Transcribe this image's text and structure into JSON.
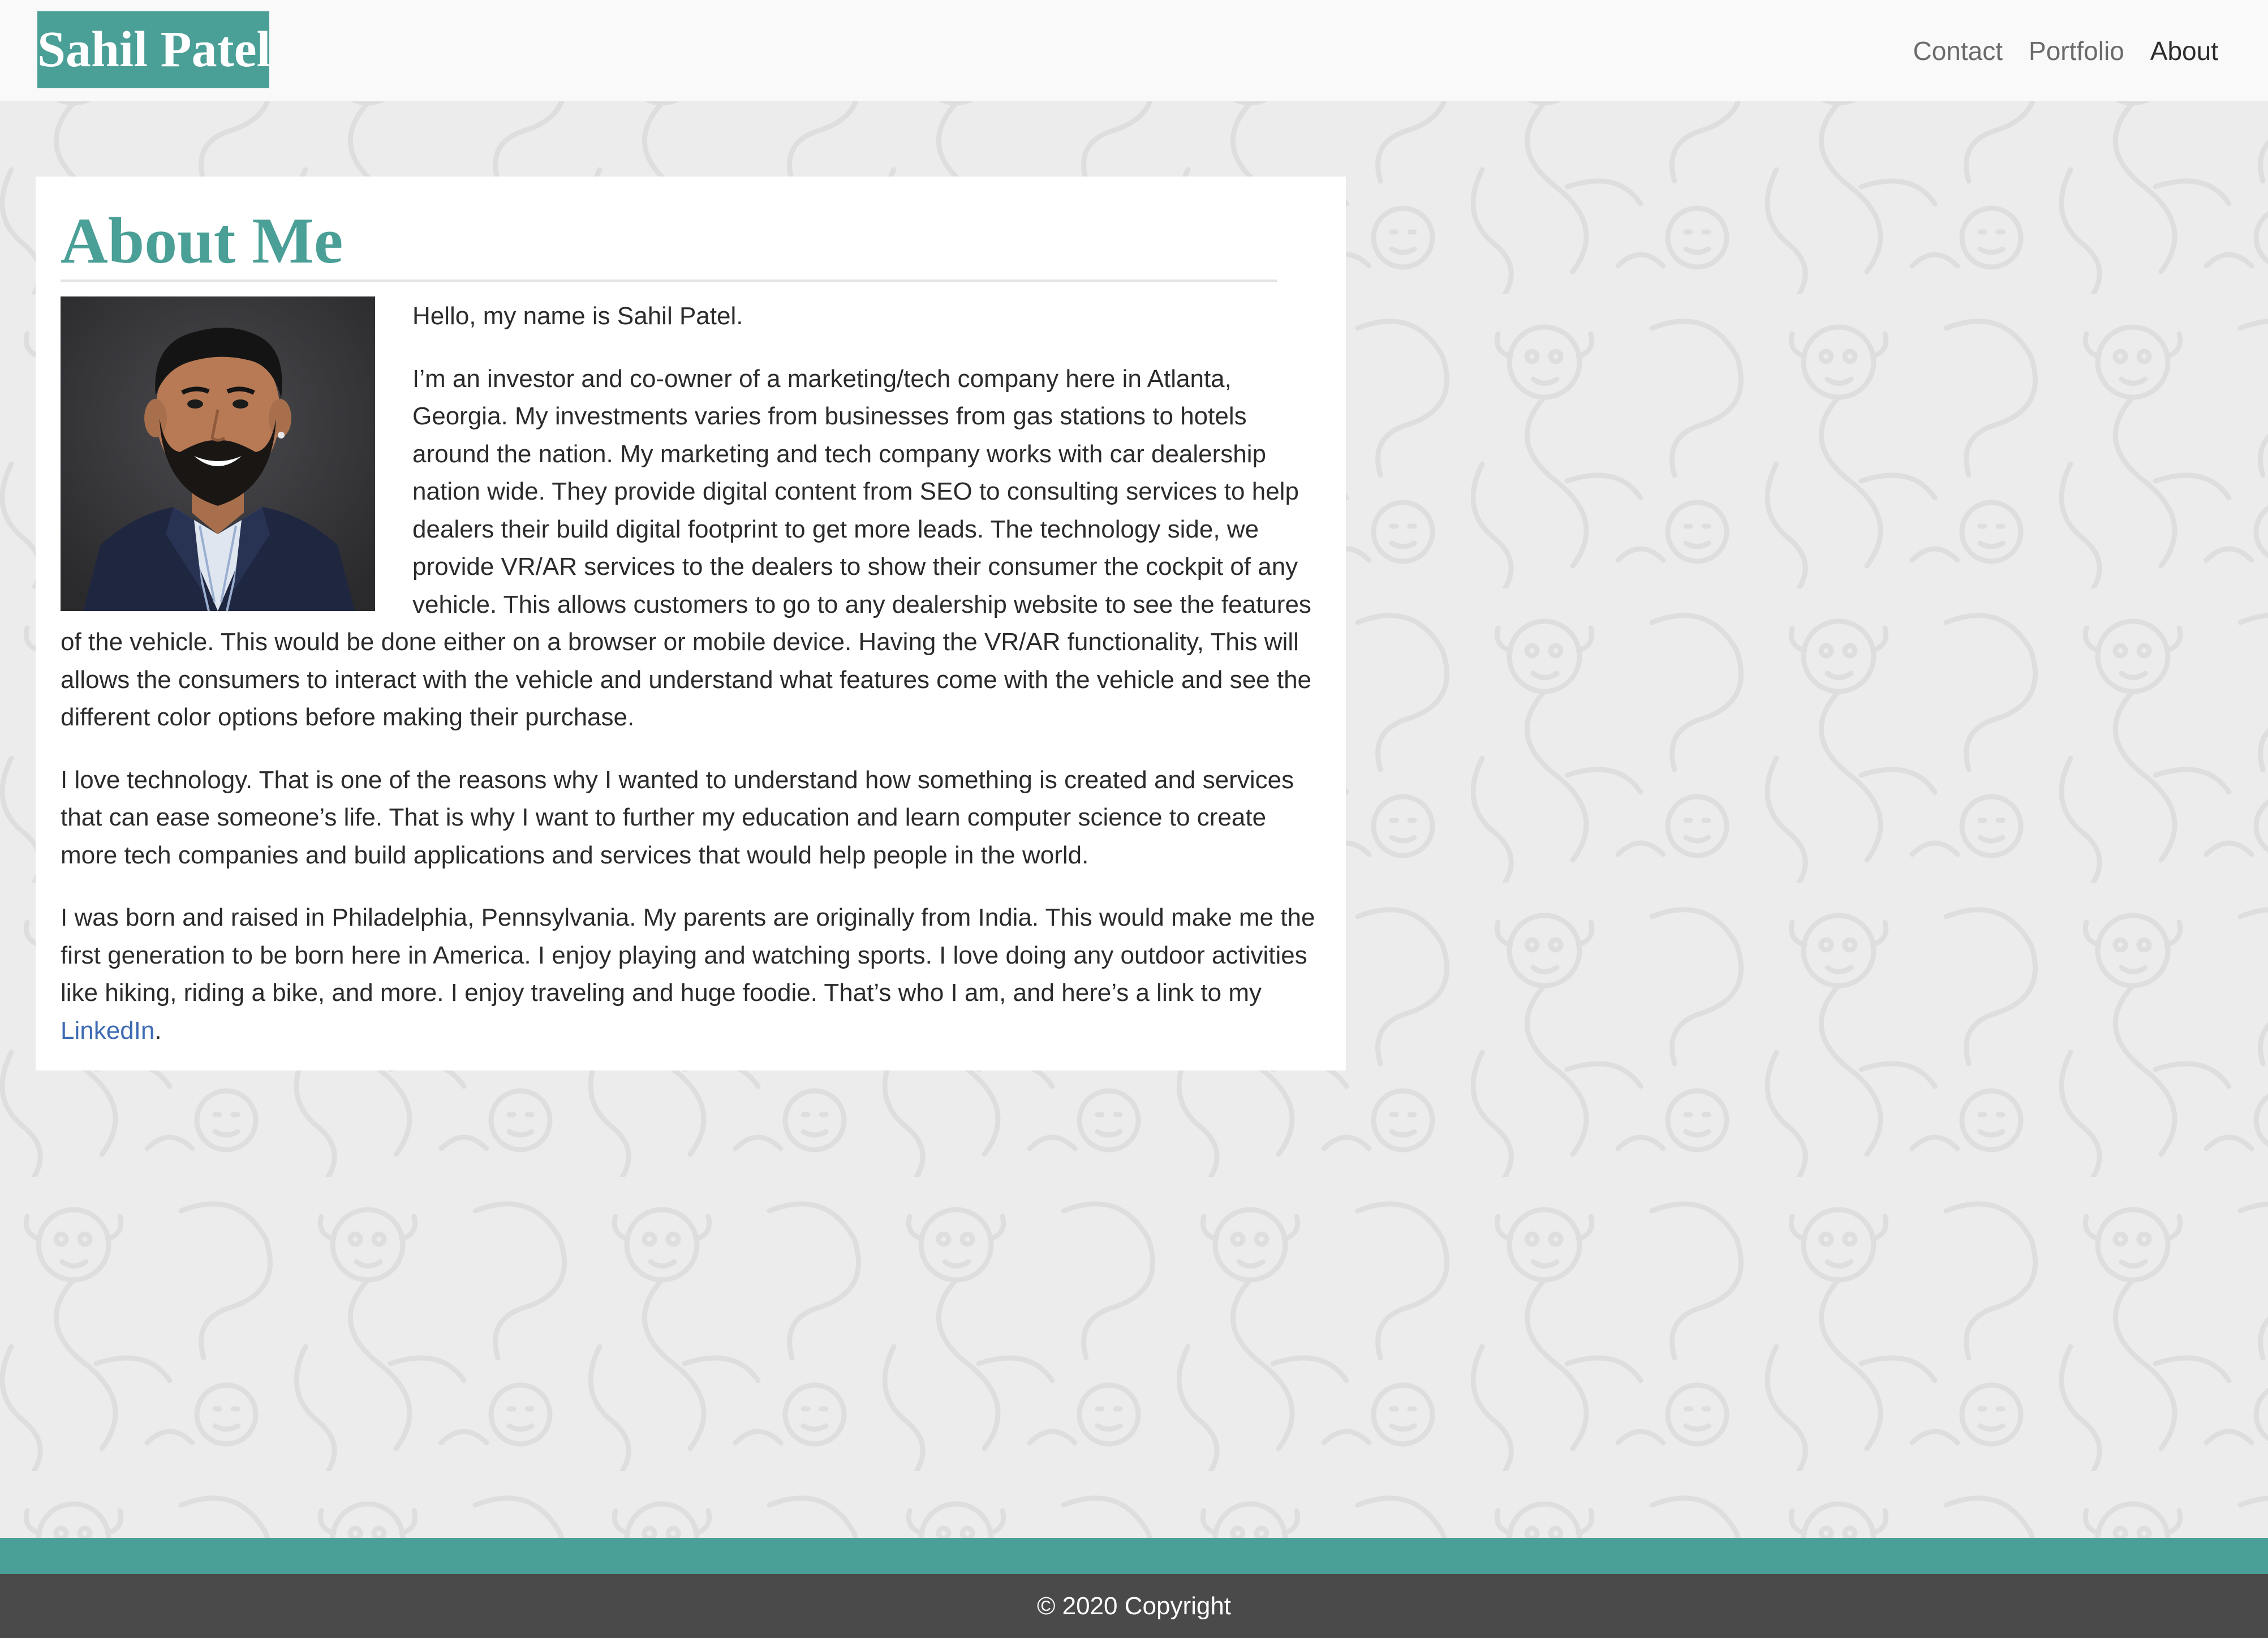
{
  "header": {
    "logo_text": "Sahil Patel",
    "nav": [
      {
        "label": "Contact"
      },
      {
        "label": "Portfolio"
      },
      {
        "label": "About"
      }
    ],
    "active_nav": "About"
  },
  "main": {
    "title": "About Me",
    "paragraph_1": "Hello, my name is Sahil Patel.",
    "paragraph_2": "I’m an investor and co-owner of a marketing/tech company here in Atlanta, Georgia. My investments varies from businesses from gas stations to hotels around the nation. My marketing and tech company works with car dealership nation wide. They provide digital content from SEO to consulting services to help dealers their build digital footprint to get more leads. The technology side, we provide VR/AR services to the dealers to show their consumer the cockpit of any vehicle. This allows customers to go to any dealership website to see the features of the vehicle. This would be done either on a browser or mobile device. Having the VR/AR functionality, This will allows the consumers to interact with the vehicle and understand what features come with the vehicle and see the different color options before making their purchase.",
    "paragraph_3": "I love technology. That is one of the reasons why I wanted to understand how something is created and services that can ease someone’s life. That is why I want to further my education and learn computer science to create more tech companies and build applications and services that would help people in the world.",
    "paragraph_4_prefix": "I was born and raised in Philadelphia, Pennsylvania. My parents are originally from India. This would make me the first generation to be born here in America. I enjoy playing and watching sports. I love doing any outdoor activities like hiking, riding a bike, and more. I enjoy traveling and huge foodie. That’s who I am, and here’s a link to my ",
    "linkedin_label": "LinkedIn",
    "paragraph_4_suffix": "."
  },
  "footer": {
    "copyright": "© 2020 Copyright"
  },
  "colors": {
    "accent": "#4a9f97",
    "header_bg": "#f9f9f9",
    "page_bg": "#ececec",
    "footer_bg": "#4a4a4a",
    "link": "#3d6bb3"
  },
  "icons": {
    "background_pattern": "monkey-doodle-pattern",
    "avatar": "profile-photo"
  }
}
